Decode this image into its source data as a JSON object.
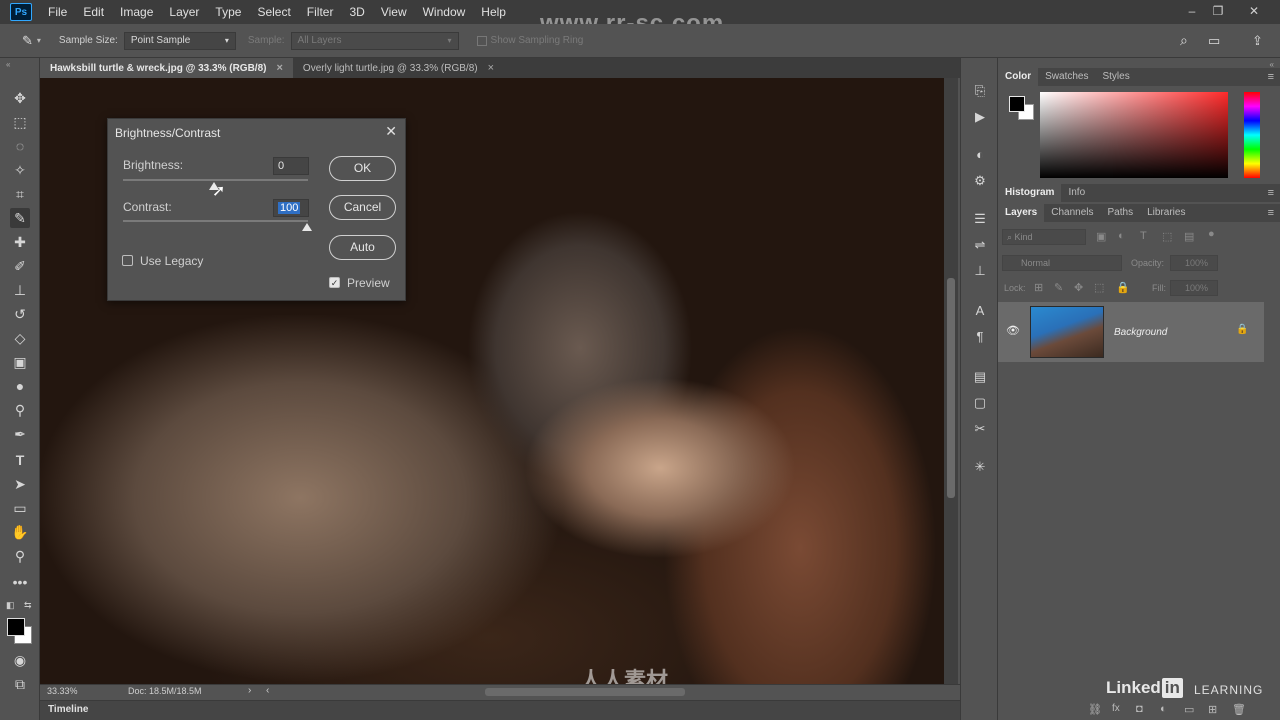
{
  "menubar": {
    "logo": "Ps",
    "items": [
      "File",
      "Edit",
      "Image",
      "Layer",
      "Type",
      "Select",
      "Filter",
      "3D",
      "View",
      "Window",
      "Help"
    ],
    "watermark": "www.rr-sc.com"
  },
  "options": {
    "sample_size_label": "Sample Size:",
    "sample_size_value": "Point Sample",
    "sample_label": "Sample:",
    "sample_value": "All Layers",
    "show_ring_label": "Show Sampling Ring"
  },
  "tabs": [
    {
      "label": "Hawksbill turtle & wreck.jpg @ 33.3% (RGB/8)",
      "close": "×"
    },
    {
      "label": "Overly light turtle.jpg @ 33.3% (RGB/8)",
      "close": "×"
    }
  ],
  "dialog": {
    "title": "Brightness/Contrast",
    "close": "✕",
    "brightness_label": "Brightness:",
    "brightness_value": "0",
    "contrast_label": "Contrast:",
    "contrast_value": "100",
    "use_legacy_label": "Use Legacy",
    "preview_label": "Preview",
    "ok_label": "OK",
    "cancel_label": "Cancel",
    "auto_label": "Auto"
  },
  "status": {
    "zoom": "33.33%",
    "doc": "Doc: 18.5M/18.5M",
    "timeline": "Timeline",
    "canvas_watermark": "人人素材"
  },
  "panels": {
    "color_tabs": [
      "Color",
      "Swatches",
      "Styles"
    ],
    "histogram_tabs": [
      "Histogram",
      "Info"
    ],
    "layers_tabs": [
      "Layers",
      "Channels",
      "Paths",
      "Libraries"
    ],
    "kind_label": "Kind",
    "blend_mode": "Normal",
    "opacity_label": "Opacity:",
    "opacity_value": "100%",
    "lock_label": "Lock:",
    "fill_label": "Fill:",
    "fill_value": "100%",
    "layer_name": "Background"
  },
  "branding": {
    "linkedin_word": "Linked",
    "linkedin_in": "in",
    "learning": "LEARNING"
  }
}
